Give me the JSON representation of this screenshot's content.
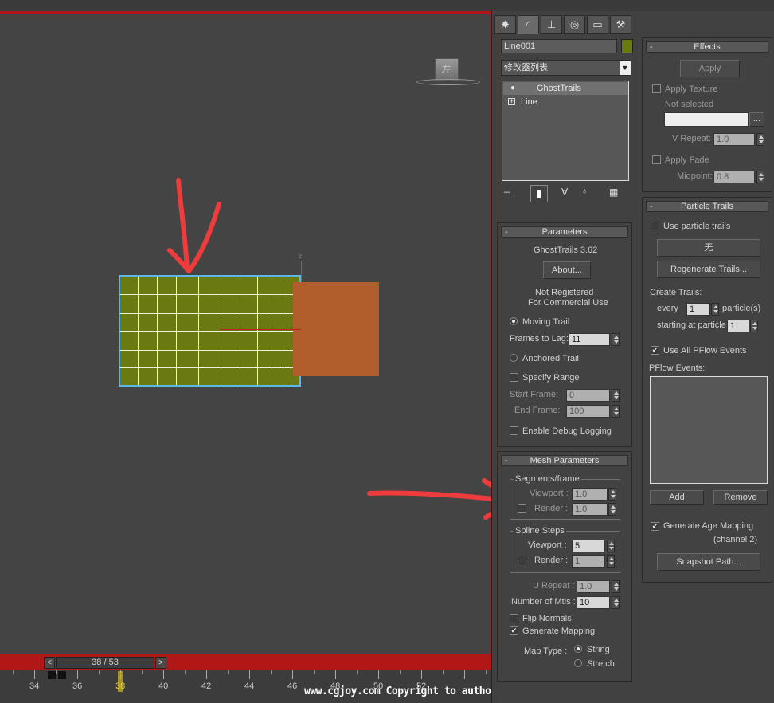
{
  "viewport": {
    "viewcube_label": "左",
    "axis_label": "z"
  },
  "timeline": {
    "slider_value": "38 / 53",
    "prev_label": "<",
    "next_label": ">",
    "ticks": [
      "34",
      "36",
      "38",
      "40",
      "42",
      "44",
      "46",
      "48",
      "50",
      "52"
    ],
    "current_frame": 38
  },
  "watermark": "www.cgjoy.com Copyright to authors",
  "command_panel": {
    "tabs": [
      {
        "name": "create-tab",
        "icon": "sun-icon",
        "glyph": "✸"
      },
      {
        "name": "modify-tab",
        "icon": "curve-icon",
        "glyph": "◜"
      },
      {
        "name": "hierarchy-tab",
        "icon": "hierarchy-icon",
        "glyph": "⊥"
      },
      {
        "name": "motion-tab",
        "icon": "motion-icon",
        "glyph": "◎"
      },
      {
        "name": "display-tab",
        "icon": "display-icon",
        "glyph": "▭"
      },
      {
        "name": "utilities-tab",
        "icon": "hammer-icon",
        "glyph": "⚒"
      }
    ],
    "object_name": "Line001",
    "object_color": "#6b7a10",
    "modifier_list": "修改器列表",
    "stack": [
      {
        "label": "GhostTrails",
        "icon": "bulb-icon"
      },
      {
        "label": "Line",
        "icon": "plus-icon"
      }
    ]
  },
  "parameters": {
    "title": "Parameters",
    "version": "GhostTrails 3.62",
    "about_label": "About...",
    "reg_line1": "Not Registered",
    "reg_line2": "For Commercial Use",
    "moving_trail": "Moving Trail",
    "frames_to_lag_label": "Frames to Lag:",
    "frames_to_lag": "11",
    "anchored_trail": "Anchored Trail",
    "specify_range": "Specify Range",
    "start_frame_label": "Start Frame:",
    "start_frame": "0",
    "end_frame_label": "End Frame:",
    "end_frame": "100",
    "debug_logging": "Enable Debug Logging"
  },
  "mesh_parameters": {
    "title": "Mesh Parameters",
    "segments_title": "Segments/frame",
    "seg_viewport_label": "Viewport :",
    "seg_viewport": "1.0",
    "seg_render_label": "Render :",
    "seg_render": "1.0",
    "spline_title": "Spline Steps",
    "spl_viewport_label": "Viewport :",
    "spl_viewport": "5",
    "spl_render_label": "Render :",
    "spl_render": "1",
    "u_repeat_label": "U Repeat :",
    "u_repeat": "1.0",
    "num_mtls_label": "Number of Mtls :",
    "num_mtls": "10",
    "flip_normals": "Flip Normals",
    "generate_mapping": "Generate Mapping",
    "map_type_label": "Map Type :",
    "string_label": "String",
    "stretch_label": "Stretch"
  },
  "effects": {
    "title": "Effects",
    "apply_label": "Apply",
    "apply_texture": "Apply Texture",
    "not_selected": "Not selected",
    "browse_label": "...",
    "v_repeat_label": "V Repeat:",
    "v_repeat": "1.0",
    "apply_fade": "Apply Fade",
    "midpoint_label": "Midpoint:",
    "midpoint": "0.8"
  },
  "particle_trails": {
    "title": "Particle Trails",
    "use_particle_trails": "Use particle trails",
    "none_label": "无",
    "regenerate_label": "Regenerate Trails...",
    "create_trails_label": "Create Trails:",
    "every_label": "every",
    "every_value": "1",
    "particles_label": "particle(s)",
    "starting_label": "starting at particle",
    "starting_value": "1",
    "use_all_events": "Use All PFlow Events",
    "pflow_events_label": "PFlow Events:",
    "add_label": "Add",
    "remove_label": "Remove",
    "gen_age_mapping": "Generate Age Mapping",
    "channel_label": "(channel 2)",
    "snapshot_label": "Snapshot Path..."
  },
  "colors": {
    "viewport_bg": "#444444",
    "active_border": "#b01818",
    "plane": "#6b7a10",
    "orange_box": "#b25e2c",
    "selection": "#5ab7e6",
    "annotation": "#ee3b3b"
  }
}
